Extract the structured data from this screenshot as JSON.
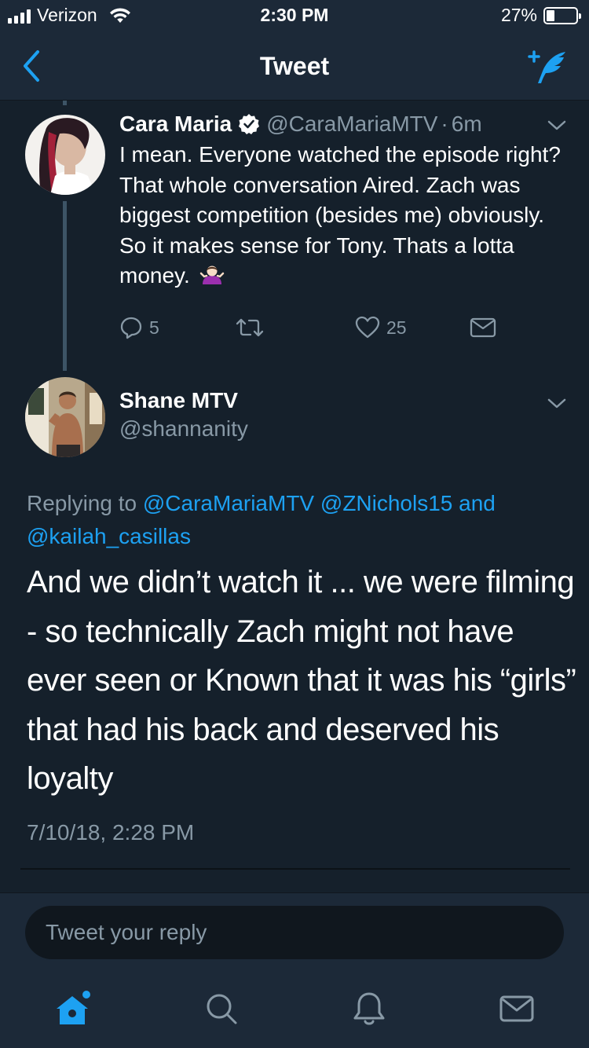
{
  "status_bar": {
    "carrier": "Verizon",
    "time": "2:30 PM",
    "battery_percent": "27%",
    "battery_level": 0.27
  },
  "nav": {
    "title": "Tweet",
    "back_icon": "chevron-left-icon",
    "compose_icon": "compose-tweet-icon"
  },
  "parent_tweet": {
    "name": "Cara Maria",
    "verified": true,
    "handle": "@CaraMariaMTV",
    "separator": "·",
    "age": "6m",
    "text": "I mean. Everyone watched the episode right? That whole conversation Aired. Zach was biggest competition (besides me) obviously. So it makes sense for Tony. Thats a lotta money.",
    "emoji": "person-shrugging-emoji",
    "reply_count": "5",
    "retweet_count": "",
    "like_count": "25"
  },
  "main_tweet": {
    "name": "Shane MTV",
    "handle": "@shannanity",
    "replying_prefix": "Replying to",
    "mention_1": "@CaraMariaMTV",
    "mention_2": "@ZNichols15",
    "and_word": "and",
    "mention_3": "@kailah_casillas",
    "text": "And we didn’t watch it ... we were filming - so technically Zach might not have ever seen or Known that it was his “girls” that had his back and deserved his loyalty",
    "timestamp": "7/10/18, 2:28 PM"
  },
  "reply": {
    "placeholder": "Tweet your reply"
  },
  "tabs": [
    "home-icon",
    "search-icon",
    "notifications-icon",
    "messages-icon"
  ],
  "colors": {
    "background": "#15202b",
    "bar": "#1c2938",
    "accent": "#1da1f2",
    "secondary_text": "#8899a6"
  }
}
